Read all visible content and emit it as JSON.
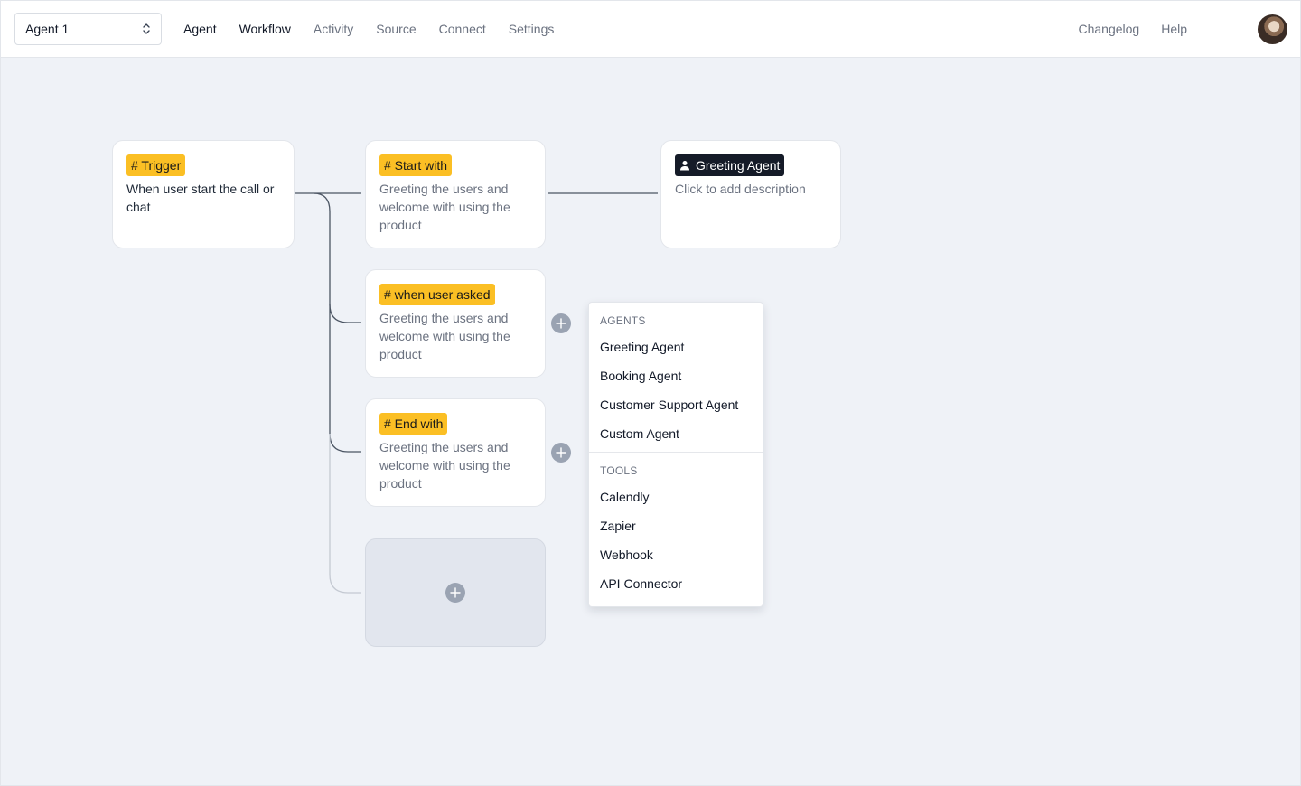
{
  "header": {
    "agent_select": "Agent 1",
    "nav": [
      "Agent",
      "Workflow",
      "Activity",
      "Source",
      "Connect",
      "Settings"
    ],
    "right_links": [
      "Changelog",
      "Help"
    ]
  },
  "nodes": {
    "trigger": {
      "tag": "# Trigger",
      "description": "When user start the call or chat"
    },
    "start_with": {
      "tag": "# Start with",
      "description": "Greeting the users and welcome with using the product"
    },
    "greeting_agent": {
      "tag": "Greeting Agent",
      "description": "Click to add description"
    },
    "when_user_asked": {
      "tag": "# when user asked",
      "description": "Greeting the users and welcome with using the product"
    },
    "end_with": {
      "tag": "# End with",
      "description": "Greeting the users and welcome with using the product"
    }
  },
  "dropdown": {
    "agents_heading": "AGENTS",
    "agents": [
      "Greeting Agent",
      "Booking Agent",
      "Customer Support Agent",
      "Custom Agent"
    ],
    "tools_heading": "TOOLS",
    "tools": [
      "Calendly",
      "Zapier",
      "Webhook",
      "API Connector"
    ]
  },
  "colors": {
    "tag_yellow": "#fbbf24",
    "tag_dark": "#151b28",
    "canvas_bg": "#eff2f7",
    "connector_line": "#4b5563"
  }
}
